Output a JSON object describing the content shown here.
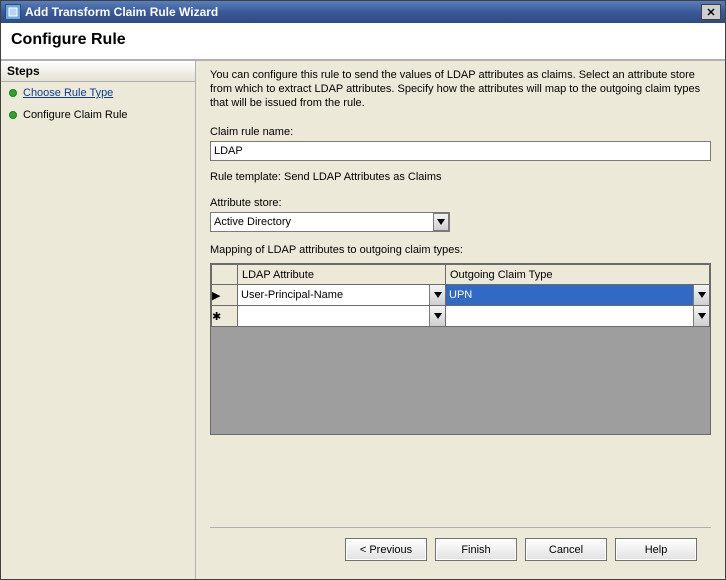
{
  "window": {
    "title": "Add Transform Claim Rule Wizard"
  },
  "header": {
    "title": "Configure Rule"
  },
  "sidebar": {
    "title": "Steps",
    "items": [
      {
        "label": "Choose Rule Type",
        "link": true
      },
      {
        "label": "Configure Claim Rule",
        "link": false
      }
    ]
  },
  "content": {
    "description": "You can configure this rule to send the values of LDAP attributes as claims. Select an attribute store from which to extract LDAP attributes. Specify how the attributes will map to the outgoing claim types that will be issued from the rule.",
    "claim_rule_name_label": "Claim rule name:",
    "claim_rule_name_value": "LDAP",
    "rule_template_text": "Rule template: Send LDAP Attributes as Claims",
    "attribute_store_label": "Attribute store:",
    "attribute_store_value": "Active Directory",
    "mapping_label": "Mapping of LDAP attributes to outgoing claim types:",
    "grid": {
      "columns": [
        "LDAP Attribute",
        "Outgoing Claim Type"
      ],
      "rows": [
        {
          "marker": "▶",
          "ldap": "User-Principal-Name",
          "claim": "UPN",
          "claim_selected": true
        },
        {
          "marker": "✱",
          "ldap": "",
          "claim": "",
          "claim_selected": false
        }
      ]
    }
  },
  "footer": {
    "previous": "< Previous",
    "finish": "Finish",
    "cancel": "Cancel",
    "help": "Help"
  }
}
